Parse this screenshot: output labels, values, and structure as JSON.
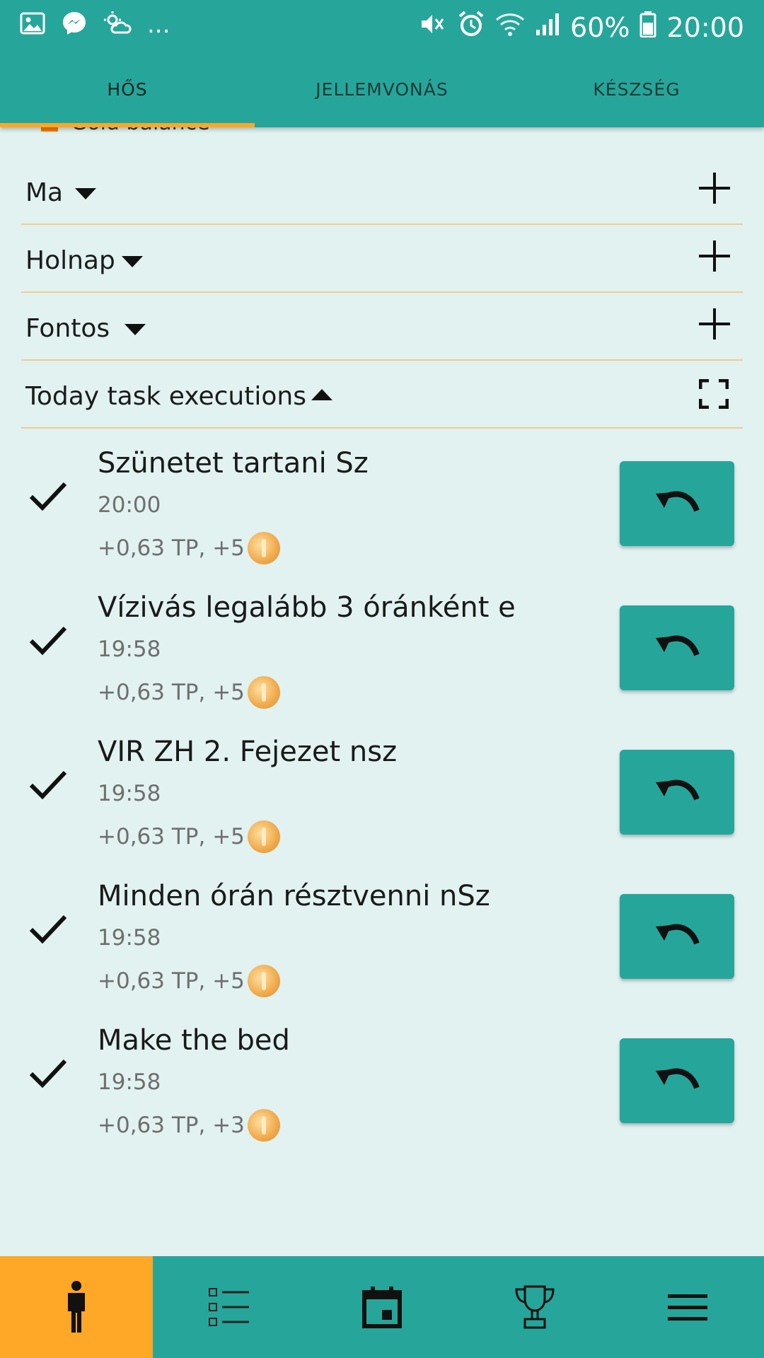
{
  "status_bar": {
    "battery": "60%",
    "time": "20:00",
    "more": "..."
  },
  "tabs": [
    {
      "label": "HŐS",
      "active": true
    },
    {
      "label": "JELLEMVONÁS",
      "active": false
    },
    {
      "label": "KÉSZSÉG",
      "active": false
    }
  ],
  "peek_label": "Gold balance",
  "sections": [
    {
      "label": "Ma",
      "expanded": false
    },
    {
      "label": "Holnap",
      "expanded": false
    },
    {
      "label": "Fontos",
      "expanded": false
    },
    {
      "label": "Today task executions",
      "expanded": true
    }
  ],
  "tasks": [
    {
      "title": "Szünetet tartani Sz",
      "time": "20:00",
      "reward": "+0,63 TP, +5"
    },
    {
      "title": "Vízivás legalább 3 óránként e",
      "time": "19:58",
      "reward": "+0,63 TP, +5"
    },
    {
      "title": "VIR ZH 2. Fejezet nsz",
      "time": "19:58",
      "reward": "+0,63 TP, +5"
    },
    {
      "title": "Minden órán résztvenni nSz",
      "time": "19:58",
      "reward": "+0,63 TP, +5"
    },
    {
      "title": "Make the bed",
      "time": "19:58",
      "reward": "+0,63 TP, +3"
    }
  ],
  "colors": {
    "primary": "#26A69A",
    "accent": "#FFA726",
    "background": "#E1F2F1",
    "divider": "#F2CB8E"
  },
  "bottom_nav": [
    {
      "icon": "hero-person-icon",
      "active": true
    },
    {
      "icon": "task-list-icon",
      "active": false
    },
    {
      "icon": "calendar-icon",
      "active": false
    },
    {
      "icon": "trophy-icon",
      "active": false
    },
    {
      "icon": "menu-icon",
      "active": false
    }
  ]
}
